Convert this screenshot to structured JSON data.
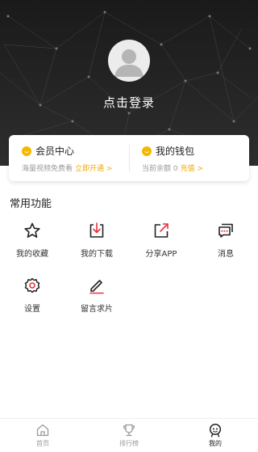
{
  "profile": {
    "login_text": "点击登录"
  },
  "cards": {
    "vip": {
      "title": "会员中心",
      "desc": "海量视频免费看",
      "action": "立即开通 >"
    },
    "wallet": {
      "title": "我的钱包",
      "desc": "当前余额 0",
      "action": "充值 >"
    }
  },
  "features": {
    "title": "常用功能",
    "items": [
      {
        "label": "我的收藏",
        "icon": "star-icon"
      },
      {
        "label": "我的下载",
        "icon": "download-icon"
      },
      {
        "label": "分享APP",
        "icon": "share-icon"
      },
      {
        "label": "消息",
        "icon": "message-icon"
      },
      {
        "label": "设置",
        "icon": "gear-icon"
      },
      {
        "label": "留言求片",
        "icon": "pen-icon"
      }
    ]
  },
  "tabbar": {
    "items": [
      {
        "label": "首页",
        "icon": "home-icon",
        "active": false
      },
      {
        "label": "排行榜",
        "icon": "trophy-icon",
        "active": false
      },
      {
        "label": "我的",
        "icon": "profile-icon",
        "active": true
      }
    ]
  },
  "colors": {
    "accent": "#f0a800",
    "coin": "#f5b800",
    "hero_bg": "#1f1f1f",
    "red": "#e8343b"
  }
}
